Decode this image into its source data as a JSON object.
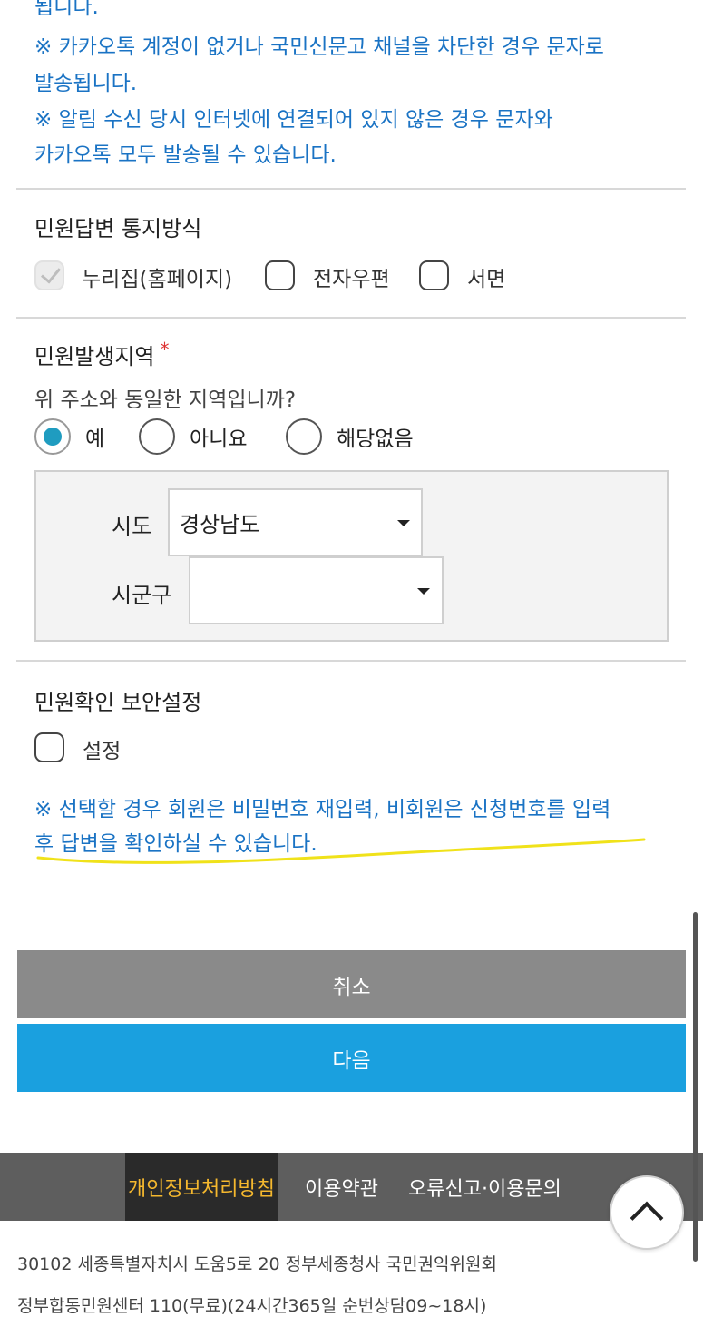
{
  "notice": {
    "cut_line": "됩니다.",
    "line1": "※ 카카오톡 계정이 없거나 국민신문고 채널을 차단한 경우 문자로",
    "line2": "발송됩니다.",
    "line3": "※ 알림 수신 당시 인터넷에 연결되어 있지 않은 경우 문자와",
    "line4": "카카오톡 모두 발송될 수 있습니다."
  },
  "reply_method": {
    "title": "민원답변 통지방식",
    "options": [
      {
        "label": "누리집(홈페이지)",
        "checked": true,
        "disabled": true
      },
      {
        "label": "전자우편",
        "checked": false
      },
      {
        "label": "서면",
        "checked": false
      }
    ]
  },
  "region": {
    "title": "민원발생지역",
    "required_mark": "*",
    "question": "위 주소와 동일한 지역입니까?",
    "options": [
      {
        "label": "예",
        "selected": true
      },
      {
        "label": "아니요",
        "selected": false
      },
      {
        "label": "해당없음",
        "selected": false
      }
    ],
    "sido_label": "시도",
    "sido_value": "경상남도",
    "sigungu_label": "시군구",
    "sigungu_value": ""
  },
  "security": {
    "title": "민원확인 보안설정",
    "checkbox_label": "설정",
    "note_line1": "※ 선택할 경우 회원은 비밀번호 재입력, 비회원은 신청번호를 입력",
    "note_line2": "후 답변을 확인하실 수 있습니다."
  },
  "buttons": {
    "cancel": "취소",
    "next": "다음"
  },
  "footer": {
    "privacy": "개인정보처리방침",
    "terms": "이용약관",
    "report": "오류신고·이용문의",
    "address": "30102 세종특별자치시 도움5로 20 정부세종청사 국민권익위원회",
    "address2": "정부합동민원센터 110(무료)(24시간365일 순번상담09~18시)"
  },
  "colors": {
    "notice_blue": "#1a73c4",
    "next_button": "#1aa0df",
    "cancel_button": "#8a8a8a",
    "radio_selected": "#1f9cc0",
    "highlighter": "#f0e21a",
    "footer_highlight": "#f5b82e"
  },
  "icons": {
    "dropdown": "caret-down-icon",
    "scroll_top": "chevron-up-icon",
    "check": "check-icon"
  }
}
